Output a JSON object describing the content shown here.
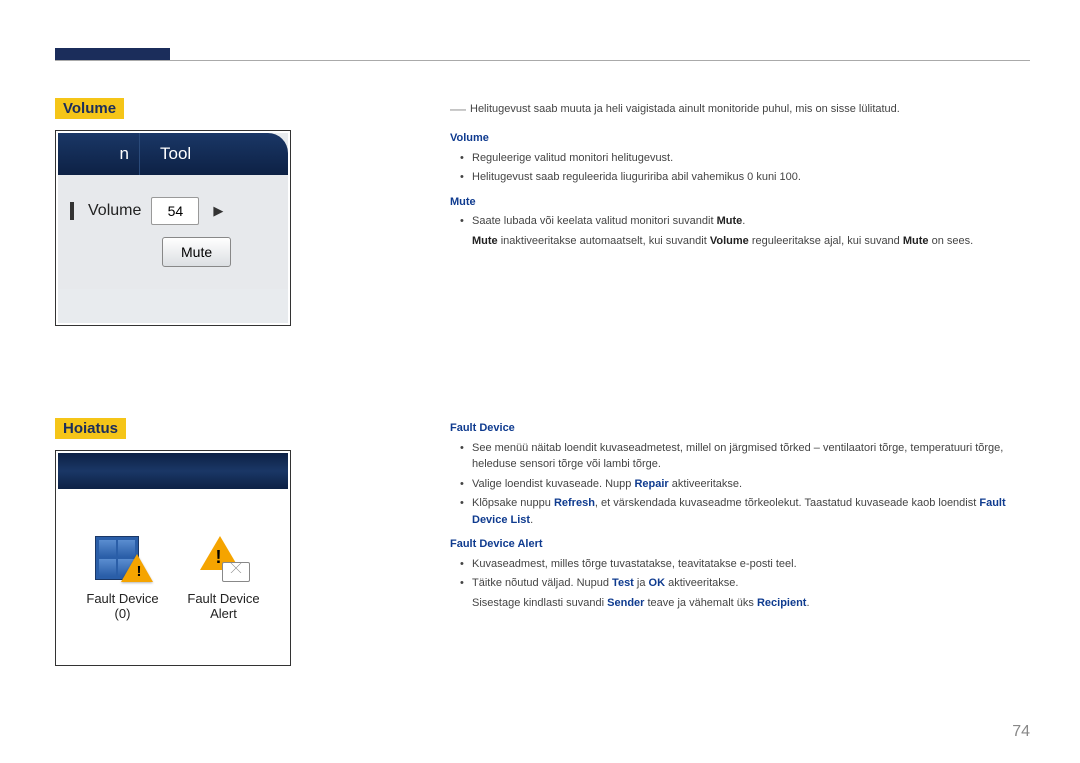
{
  "headings": {
    "volume": "Volume",
    "alert": "Hoiatus"
  },
  "panel1": {
    "tab_left": "n",
    "tab_right": "Tool",
    "vol_label": "Volume",
    "vol_value": "54",
    "mute_btn": "Mute"
  },
  "panel2": {
    "item1_line1": "Fault Device",
    "item1_line2": "(0)",
    "item2_line1": "Fault Device",
    "item2_line2": "Alert"
  },
  "text1": {
    "intro": "Helitugevust saab muuta ja heli vaigistada ainult monitoride puhul, mis on sisse lülitatud.",
    "h_volume": "Volume",
    "vol_b1": "Reguleerige valitud monitori helitugevust.",
    "vol_b2": "Helitugevust saab reguleerida liuguririba abil vahemikus 0 kuni 100.",
    "h_mute": "Mute",
    "mute_b1_a": "Saate lubada või keelata valitud monitori suvandit ",
    "mute_b1_b": "Mute",
    "mute_b1_c": ".",
    "mute_line2_a": "Mute",
    "mute_line2_b": " inaktiveeritakse automaatselt, kui suvandit ",
    "mute_line2_c": "Volume",
    "mute_line2_d": " reguleeritakse ajal, kui suvand ",
    "mute_line2_e": "Mute",
    "mute_line2_f": " on sees."
  },
  "text2": {
    "h_fd": "Fault Device",
    "fd_b1": "See menüü näitab loendit kuvaseadmetest, millel on järgmised tõrked – ventilaatori tõrge, temperatuuri tõrge, heleduse sensori tõrge või lambi tõrge.",
    "fd_b2_a": "Valige loendist kuvaseade. Nupp ",
    "fd_b2_b": "Repair",
    "fd_b2_c": " aktiveeritakse.",
    "fd_b3_a": "Klõpsake nuppu ",
    "fd_b3_b": "Refresh",
    "fd_b3_c": ", et värskendada kuvaseadme tõrkeolekut. Taastatud kuvaseade kaob loendist ",
    "fd_b3_d": "Fault Device List",
    "fd_b3_e": ".",
    "h_fda": "Fault Device Alert",
    "fda_b1": "Kuvaseadmest, milles tõrge tuvastatakse, teavitatakse e-posti teel.",
    "fda_b2_a": "Täitke nõutud väljad. Nupud ",
    "fda_b2_b": "Test",
    "fda_b2_c": " ja ",
    "fda_b2_d": "OK",
    "fda_b2_e": " aktiveeritakse.",
    "fda_line2_a": "Sisestage kindlasti suvandi ",
    "fda_line2_b": "Sender",
    "fda_line2_c": " teave ja vähemalt üks ",
    "fda_line2_d": "Recipient",
    "fda_line2_e": "."
  },
  "page_number": "74"
}
